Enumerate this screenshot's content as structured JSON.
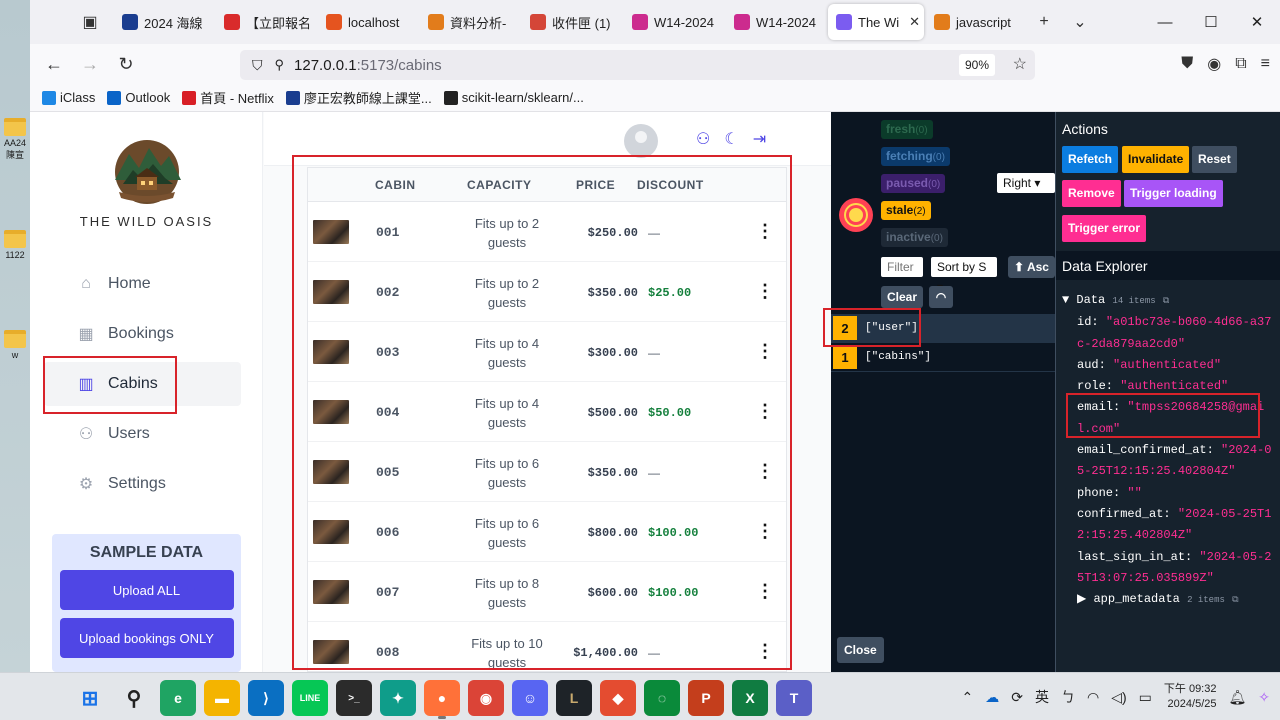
{
  "desktop": {
    "icons": [
      {
        "label": "AA24\n陳宣"
      },
      {
        "label": "1122"
      },
      {
        "label": "w"
      }
    ]
  },
  "browser": {
    "tabs": [
      {
        "label": "2024 海線",
        "color": "#1a3d8f"
      },
      {
        "label": "【立即報名",
        "color": "#d92b2b"
      },
      {
        "label": "localhost",
        "color": "#e5541f"
      },
      {
        "label": "資料分析-",
        "color": "#e27c1b"
      },
      {
        "label": "收件匣 (1)",
        "color": "#d44638"
      },
      {
        "label": "W14-2024",
        "color": "#cc2b8e"
      },
      {
        "label": "W14-2024",
        "color": "#cc2b8e"
      },
      {
        "label": "The Wi",
        "color": "#7b5cf0",
        "active": true
      },
      {
        "label": "javascript",
        "color": "#e27c1b"
      }
    ],
    "url_host": "127.0.0.1",
    "url_path": ":5173/cabins",
    "zoom": "90%",
    "bookmarks": [
      {
        "label": "iClass",
        "color": "#1e88e5"
      },
      {
        "label": "Outlook",
        "color": "#0a64c8"
      },
      {
        "label": "首頁 - Netflix",
        "color": "#d81f26"
      },
      {
        "label": "廖正宏教師線上課堂...",
        "color": "#1a3d8f"
      },
      {
        "label": "scikit-learn/sklearn/...",
        "color": "#222222"
      }
    ]
  },
  "app": {
    "brand": "THE WILD OASIS",
    "nav": [
      {
        "label": "Home",
        "icon": "home-icon"
      },
      {
        "label": "Bookings",
        "icon": "calendar-icon"
      },
      {
        "label": "Cabins",
        "icon": "building-icon",
        "active": true
      },
      {
        "label": "Users",
        "icon": "users-icon"
      },
      {
        "label": "Settings",
        "icon": "gear-icon"
      }
    ],
    "sample": {
      "title": "SAMPLE DATA",
      "btn_all": "Upload ALL",
      "btn_bookings": "Upload bookings ONLY"
    },
    "table": {
      "headers": [
        "CABIN",
        "CAPACITY",
        "PRICE",
        "DISCOUNT"
      ],
      "rows": [
        {
          "cabin": "001",
          "capacity": "Fits up to 2 guests",
          "price": "$250.00",
          "discount": "—"
        },
        {
          "cabin": "002",
          "capacity": "Fits up to 2 guests",
          "price": "$350.00",
          "discount": "$25.00"
        },
        {
          "cabin": "003",
          "capacity": "Fits up to 4 guests",
          "price": "$300.00",
          "discount": "—"
        },
        {
          "cabin": "004",
          "capacity": "Fits up to 4 guests",
          "price": "$500.00",
          "discount": "$50.00"
        },
        {
          "cabin": "005",
          "capacity": "Fits up to 6 guests",
          "price": "$350.00",
          "discount": "—"
        },
        {
          "cabin": "006",
          "capacity": "Fits up to 6 guests",
          "price": "$800.00",
          "discount": "$100.00"
        },
        {
          "cabin": "007",
          "capacity": "Fits up to 8 guests",
          "price": "$600.00",
          "discount": "$100.00"
        },
        {
          "cabin": "008",
          "capacity": "Fits up to 10 guests",
          "price": "$1,400.00",
          "discount": "—"
        }
      ]
    }
  },
  "devtools": {
    "chips": [
      {
        "label": "fresh",
        "count": "(0)",
        "bg": "#0b3b2a",
        "fg": "#2d6a4f"
      },
      {
        "label": "fetching",
        "count": "(0)",
        "bg": "#0b3a6b",
        "fg": "#4a7fb5"
      },
      {
        "label": "paused",
        "count": "(0)",
        "bg": "#3b1f6b",
        "fg": "#7a5bb0"
      },
      {
        "label": "stale",
        "count": "(2)",
        "bg": "#ffb200",
        "fg": "#111111"
      },
      {
        "label": "inactive",
        "count": "(0)",
        "bg": "#1e2936",
        "fg": "#5a6878"
      }
    ],
    "position": "Right",
    "filter_placeholder": "Filter",
    "sort": "Sort by S",
    "asc": "⬆ Asc",
    "clear": "Clear",
    "queries": [
      {
        "count": "2",
        "key": "[\"user\"]"
      },
      {
        "count": "1",
        "key": "[\"cabins\"]"
      }
    ],
    "actions_title": "Actions",
    "actions": [
      {
        "label": "Refetch",
        "bg": "#0b7de0",
        "fg": "#ffffff"
      },
      {
        "label": "Invalidate",
        "bg": "#ffb200",
        "fg": "#111111"
      },
      {
        "label": "Reset",
        "bg": "#3f4e60",
        "fg": "#ffffff"
      },
      {
        "label": "Remove",
        "bg": "#ff2e92",
        "fg": "#ffffff"
      },
      {
        "label": "Trigger loading",
        "bg": "#a855f7",
        "fg": "#ffffff"
      },
      {
        "label": "Trigger error",
        "bg": "#ff2e92",
        "fg": "#ffffff"
      }
    ],
    "explorer_title": "Data Explorer",
    "data_label": "Data",
    "data_count": "14 items",
    "entries": [
      {
        "key": "id:",
        "val": "\"a01bc73e-b060-4d66-a37c-2da879aa2cd0\""
      },
      {
        "key": "aud:",
        "val": "\"authenticated\""
      },
      {
        "key": "role:",
        "val": "\"authenticated\""
      },
      {
        "key": "email:",
        "val": "\"tmpss20684258@gmail.com\""
      },
      {
        "key": "email_confirmed_at:",
        "val": "\"2024-05-25T12:15:25.402804Z\""
      },
      {
        "key": "phone:",
        "val": "\"\""
      },
      {
        "key": "confirmed_at:",
        "val": "\"2024-05-25T12:15:25.402804Z\""
      },
      {
        "key": "last_sign_in_at:",
        "val": "\"2024-05-25T13:07:25.035899Z\""
      }
    ],
    "app_metadata": "app_metadata",
    "app_metadata_count": "2 items",
    "close": "Close"
  },
  "taskbar": {
    "ime": "英",
    "time": "下午 09:32",
    "date": "2024/5/25"
  }
}
